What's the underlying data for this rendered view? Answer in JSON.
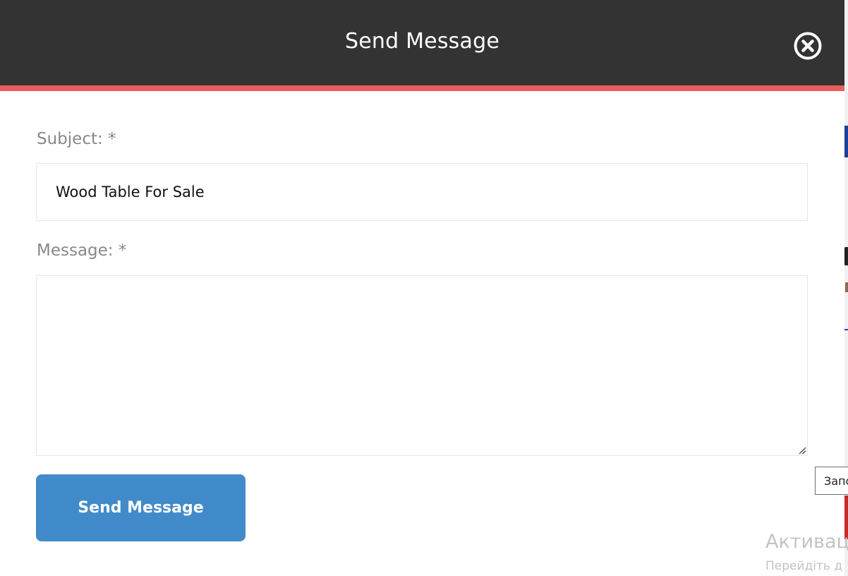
{
  "modal": {
    "title": "Send Message",
    "close_icon": "close-circle-icon",
    "subject_label": "Subject: *",
    "subject_value": "Wood Table For Sale",
    "message_label": "Message: *",
    "message_value": "",
    "send_button_label": "Send Message"
  },
  "colors": {
    "header_bg": "#333333",
    "header_accent": "#e85d5d",
    "button_bg": "#428bca",
    "label_text": "#888888"
  },
  "overlay": {
    "tooltip_text": "Запо",
    "watermark_title": "Активац",
    "watermark_subtitle": "Перейдіть д"
  }
}
